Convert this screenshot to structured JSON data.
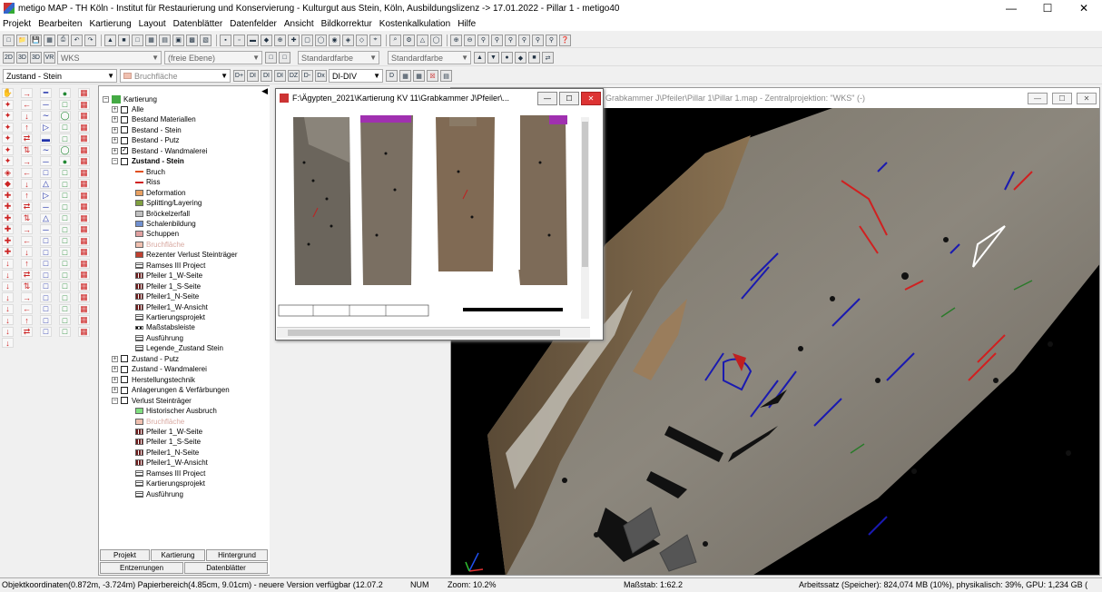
{
  "window": {
    "title": "metigo MAP - TH Köln - Institut für Restaurierung und Konservierung - Kulturgut aus Stein, Köln, Ausbildungslizenz -> 17.01.2022 - Pillar 1 - metigo40"
  },
  "menu": [
    "Projekt",
    "Bearbeiten",
    "Kartierung",
    "Layout",
    "Datenblätter",
    "Datenfelder",
    "Ansicht",
    "Bildkorrektur",
    "Kostenkalkulation",
    "Hilfe"
  ],
  "toolbar2": {
    "buttons": [
      "2D",
      "3D",
      "3D",
      "VR"
    ],
    "view_combo": "WKS",
    "plane_combo": "(freie Ebene)",
    "color1": "Standardfarbe",
    "color2": "Standardfarbe"
  },
  "toolbar3": {
    "layer_combo": "Zustand - Stein",
    "layer2_combo": "Bruchfläche",
    "din_buttons": [
      "D+",
      "DI",
      "DI",
      "DI",
      "DZ",
      "D-",
      "Dx"
    ],
    "din_combo": "DI-DIV"
  },
  "tree": {
    "root": "Kartierung",
    "items": [
      {
        "label": "Alle",
        "level": 1,
        "type": "cb"
      },
      {
        "label": "Bestand Materiallen",
        "level": 1,
        "type": "cb"
      },
      {
        "label": "Bestand - Stein",
        "level": 1,
        "type": "cb"
      },
      {
        "label": "Bestand - Putz",
        "level": 1,
        "type": "cb"
      },
      {
        "label": "Bestand - Wandmalerei",
        "level": 1,
        "type": "cbx"
      },
      {
        "label": "Zustand - Stein",
        "level": 1,
        "type": "cb",
        "bold": true
      },
      {
        "label": "Bruch",
        "level": 2,
        "sw": "line",
        "color": "#e05020"
      },
      {
        "label": "Riss",
        "level": 2,
        "sw": "line",
        "color": "#d02020"
      },
      {
        "label": "Deformation",
        "level": 2,
        "sw": "box",
        "color": "#e8a060"
      },
      {
        "label": "Splitting/Layering",
        "level": 2,
        "sw": "box",
        "color": "#80a040"
      },
      {
        "label": "Bröckelzerfall",
        "level": 2,
        "sw": "box",
        "color": "#c0c0c0"
      },
      {
        "label": "Schalenbildung",
        "level": 2,
        "sw": "box",
        "color": "#7090d0"
      },
      {
        "label": "Schuppen",
        "level": 2,
        "sw": "box",
        "color": "#e0a0a0"
      },
      {
        "label": "Bruchfläche",
        "level": 2,
        "sw": "box",
        "color": "#f0c0b0",
        "grey": true
      },
      {
        "label": "Rezenter Verlust Steinträger",
        "level": 2,
        "sw": "box",
        "color": "#c04030"
      },
      {
        "label": "Ramses III Project",
        "level": 2,
        "sw": "tbl"
      },
      {
        "label": "Pfeiler 1_W-Seite",
        "level": 2,
        "sw": "tbl2"
      },
      {
        "label": "Pfeiler 1_S-Seite",
        "level": 2,
        "sw": "tbl2"
      },
      {
        "label": "Pfeiler1_N-Seite",
        "level": 2,
        "sw": "tbl2"
      },
      {
        "label": "Pfeiler1_W-Ansicht",
        "level": 2,
        "sw": "tbl2"
      },
      {
        "label": "Kartierungsprojekt",
        "level": 2,
        "sw": "tbl"
      },
      {
        "label": "Maßstabsleiste",
        "level": 2,
        "sw": "scale"
      },
      {
        "label": "Ausführung",
        "level": 2,
        "sw": "tbl"
      },
      {
        "label": "Legende_Zustand Stein",
        "level": 2,
        "sw": "tbl"
      },
      {
        "label": "Zustand - Putz",
        "level": 1,
        "type": "cb"
      },
      {
        "label": "Zustand - Wandmalerei",
        "level": 1,
        "type": "cb"
      },
      {
        "label": "Herstellungstechnik",
        "level": 1,
        "type": "cb"
      },
      {
        "label": "Anlagerungen & Verfärbungen",
        "level": 1,
        "type": "cb"
      },
      {
        "label": "Verlust Steinträger",
        "level": 1,
        "type": "cb"
      },
      {
        "label": "Historischer Ausbruch",
        "level": 2,
        "sw": "box",
        "color": "#80e080"
      },
      {
        "label": "Bruchfläche",
        "level": 2,
        "sw": "box",
        "color": "#f0c0b0",
        "grey": true
      },
      {
        "label": "Pfeiler 1_W-Seite",
        "level": 2,
        "sw": "tbl2"
      },
      {
        "label": "Pfeiler 1_S-Seite",
        "level": 2,
        "sw": "tbl2"
      },
      {
        "label": "Pfeiler1_N-Seite",
        "level": 2,
        "sw": "tbl2"
      },
      {
        "label": "Pfeiler1_W-Ansicht",
        "level": 2,
        "sw": "tbl2"
      },
      {
        "label": "Ramses III Project",
        "level": 2,
        "sw": "tbl"
      },
      {
        "label": "Kartierungsprojekt",
        "level": 2,
        "sw": "tbl"
      },
      {
        "label": "Ausführung",
        "level": 2,
        "sw": "tbl"
      }
    ]
  },
  "tabs": {
    "row1": [
      "Projekt",
      "Kartierung",
      "Hintergrund"
    ],
    "row2": [
      "Entzerrungen",
      "Datenblätter"
    ]
  },
  "child_window": {
    "title": "F:\\Ägypten_2021\\Kartierung KV 11\\Grabkammer J\\Pfeiler\\..."
  },
  "view3d": {
    "title": "Grabkammer J\\Pfeiler\\Pillar 1\\Pillar 1.map - Zentralprojektion: \"WKS\" (-)"
  },
  "status": {
    "coords": "Objektkoordinaten(0.872m, -3.724m) Papierbereich(4.85cm, 9.01cm) - neuere Version verfügbar (12.07.2",
    "num": "NUM",
    "zoom": "Zoom: 10.2%",
    "scale": "Maßstab: 1:62.2",
    "memory": "Arbeitssatz (Speicher): 824,074 MB (10%), physikalisch: 39%, GPU: 1,234 GB ("
  }
}
